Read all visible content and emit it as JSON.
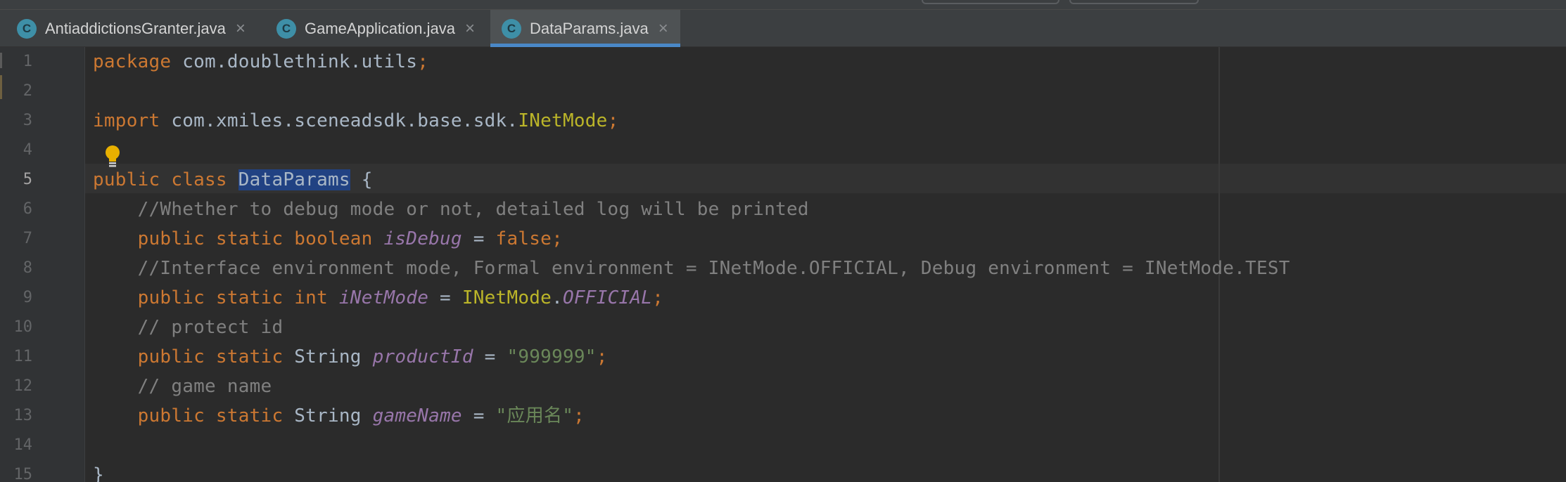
{
  "tabs": [
    {
      "icon": "C",
      "label": "AntiaddictionsGranter.java",
      "close": "×",
      "active": false
    },
    {
      "icon": "C",
      "label": "GameApplication.java",
      "close": "×",
      "active": false
    },
    {
      "icon": "C",
      "label": "DataParams.java",
      "close": "×",
      "active": true
    }
  ],
  "editor": {
    "current_line": 5,
    "line_numbers": [
      "1",
      "2",
      "3",
      "4",
      "5",
      "6",
      "7",
      "8",
      "9",
      "10",
      "11",
      "12",
      "13",
      "14",
      "15"
    ],
    "lines": {
      "l1": {
        "kw": "package",
        "text": " com.doublethink.utils",
        "semi": ";"
      },
      "l3": {
        "kw": "import",
        "text": " com.xmiles.sceneadsdk.base.sdk.",
        "cls": "INetMode",
        "semi": ";"
      },
      "l5": {
        "kw": "public class",
        "sp": " ",
        "cls": "DataParams",
        "text": " {"
      },
      "l6": {
        "comment": "    //Whether to debug mode or not, detailed log will be printed"
      },
      "l7": {
        "kw": "    public static boolean",
        "field": "isDebug",
        "eq": " = ",
        "val": "false",
        "semi": ";"
      },
      "l8": {
        "comment": "    //Interface environment mode, Formal environment = INetMode.OFFICIAL, Debug environment = INetMode.TEST"
      },
      "l9": {
        "kw": "    public static int",
        "field": "iNetMode",
        "eq": " = ",
        "cls": "INetMode",
        "dot": ".",
        "const": "OFFICIAL",
        "semi": ";"
      },
      "l10": {
        "comment": "    // protect id"
      },
      "l11": {
        "kw": "    public static",
        "type": " String ",
        "field": "productId",
        "eq": " = ",
        "str": "\"999999\"",
        "semi": ";"
      },
      "l12": {
        "comment": "    // game name"
      },
      "l13": {
        "kw": "    public static",
        "type": " String ",
        "field": "gameName",
        "eq": " = ",
        "str": "\"应用名\"",
        "semi": ";"
      },
      "l15": {
        "text": "}"
      }
    }
  },
  "intention_bulb": {
    "icon": "lightbulb-icon",
    "color": "#e8b000"
  },
  "colors": {
    "keyword": "#cc7832",
    "comment": "#808080",
    "string": "#6a8759",
    "field": "#9876aa",
    "class_ref": "#bbb529",
    "selection": "#214283",
    "tab_underline": "#4a88c7"
  }
}
